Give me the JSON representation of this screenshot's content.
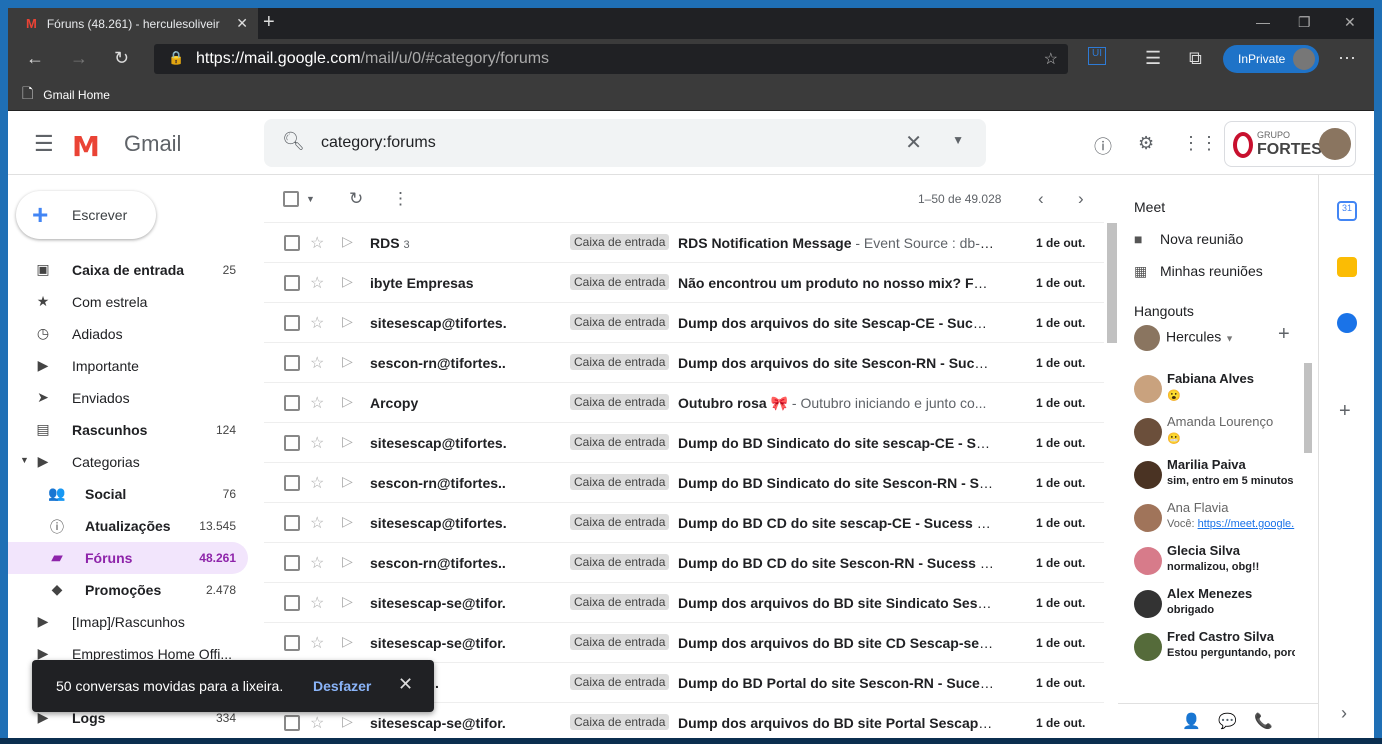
{
  "browser": {
    "tab_title": "Fóruns (48.261) - herculesoliveir",
    "favicon": "M",
    "url_host": "https://mail.google.com",
    "url_path": "/mail/u/0/#category/forums",
    "inprivate": "InPrivate",
    "favorite": "Gmail Home"
  },
  "header": {
    "app_name": "Gmail",
    "search_query": "category:forums",
    "brand_top": "GRUPO",
    "brand_name": "FORTES"
  },
  "compose": "Escrever",
  "nav": [
    {
      "label": "Caixa de entrada",
      "count": "25",
      "icon": "inbox-icon",
      "glyph": "▣",
      "bold": true
    },
    {
      "label": "Com estrela",
      "count": "",
      "icon": "star-icon",
      "glyph": "★",
      "bold": false
    },
    {
      "label": "Adiados",
      "count": "",
      "icon": "clock-icon",
      "glyph": "◷",
      "bold": false
    },
    {
      "label": "Importante",
      "count": "",
      "icon": "important-icon",
      "glyph": "▶",
      "bold": false
    },
    {
      "label": "Enviados",
      "count": "",
      "icon": "send-icon",
      "glyph": "➤",
      "bold": false
    },
    {
      "label": "Rascunhos",
      "count": "124",
      "icon": "draft-icon",
      "glyph": "▤",
      "bold": true
    },
    {
      "label": "Categorias",
      "count": "",
      "icon": "label-icon",
      "glyph": "▶",
      "bold": false
    },
    {
      "label": "Social",
      "count": "76",
      "icon": "people-icon",
      "glyph": "👥",
      "sub": true
    },
    {
      "label": "Atualizações",
      "count": "13.545",
      "icon": "info-icon",
      "glyph": "ⓘ",
      "sub": true
    },
    {
      "label": "Fóruns",
      "count": "48.261",
      "icon": "forum-icon",
      "glyph": "▰",
      "sub": true,
      "active": true
    },
    {
      "label": "Promoções",
      "count": "2.478",
      "icon": "tag-icon",
      "glyph": "◆",
      "sub": true
    },
    {
      "label": "[Imap]/Rascunhos",
      "count": "",
      "icon": "label-icon",
      "glyph": "▶",
      "bold": false
    },
    {
      "label": "Emprestimos Home Offi...",
      "count": "",
      "icon": "label-icon",
      "glyph": "▶",
      "bold": false
    },
    {
      "label": "",
      "count": "",
      "icon": "label-icon",
      "glyph": "",
      "bold": false
    },
    {
      "label": "Logs",
      "count": "334",
      "icon": "label-icon",
      "glyph": "▶",
      "bold": true
    }
  ],
  "toolbar": {
    "pagination": "1–50 de 49.028"
  },
  "emails": [
    {
      "sender": "RDS",
      "thread": "3",
      "label": "Caixa de entrada",
      "subject": "RDS Notification Message",
      "snippet": " - Event Source : db-i...",
      "date": "1 de out."
    },
    {
      "sender": "ibyte Empresas",
      "thread": "",
      "label": "Caixa de entrada",
      "subject": "Não encontrou um produto no nosso mix? Faça...",
      "snippet": "",
      "date": "1 de out."
    },
    {
      "sender": "sitesescap@tifortes.",
      "thread": "",
      "label": "Caixa de entrada",
      "subject": "Dump dos arquivos do site Sescap-CE - Sucess",
      "snippet": " -",
      "date": "1 de out."
    },
    {
      "sender": "sescon-rn@tifortes..",
      "thread": "",
      "label": "Caixa de entrada",
      "subject": "Dump dos arquivos do site Sescon-RN - Sucess",
      "snippet": " -",
      "date": "1 de out."
    },
    {
      "sender": "Arcopy",
      "thread": "",
      "label": "Caixa de entrada",
      "subject": "Outubro rosa 🎀",
      "snippet": " - Outubro iniciando e junto co...",
      "date": "1 de out."
    },
    {
      "sender": "sitesescap@tifortes.",
      "thread": "",
      "label": "Caixa de entrada",
      "subject": "Dump do BD Sindicato do site sescap-CE - Suc...",
      "snippet": "",
      "date": "1 de out."
    },
    {
      "sender": "sescon-rn@tifortes..",
      "thread": "",
      "label": "Caixa de entrada",
      "subject": "Dump do BD Sindicato do site Sescon-RN - Su...",
      "snippet": "",
      "date": "1 de out."
    },
    {
      "sender": "sitesescap@tifortes.",
      "thread": "",
      "label": "Caixa de entrada",
      "subject": "Dump do BD CD do site sescap-CE - Sucess",
      "snippet": " - A...",
      "date": "1 de out."
    },
    {
      "sender": "sescon-rn@tifortes..",
      "thread": "",
      "label": "Caixa de entrada",
      "subject": "Dump do BD CD do site Sescon-RN - Sucess",
      "snippet": " - A...",
      "date": "1 de out."
    },
    {
      "sender": "sitesescap-se@tifor.",
      "thread": "",
      "label": "Caixa de entrada",
      "subject": "Dump dos arquivos do BD site Sindicato Sesca...",
      "snippet": "",
      "date": "1 de out."
    },
    {
      "sender": "sitesescap-se@tifor.",
      "thread": "",
      "label": "Caixa de entrada",
      "subject": "Dump dos arquivos do BD site CD Sescap-se",
      "snippet": " - A...",
      "date": "1 de out."
    },
    {
      "sender": "@tifortes..",
      "thread": "",
      "label": "Caixa de entrada",
      "subject": "Dump do BD Portal do site Sescon-RN - Sucess",
      "snippet": " -",
      "date": "1 de out."
    },
    {
      "sender": "sitesescap-se@tifor.",
      "thread": "",
      "label": "Caixa de entrada",
      "subject": "Dump dos arquivos do BD site Portal Sescap-se",
      "snippet": " -",
      "date": "1 de out."
    }
  ],
  "right_panel": {
    "meet_title": "Meet",
    "new_meeting": "Nova reunião",
    "my_meetings": "Minhas reuniões",
    "hangouts_title": "Hangouts",
    "user": "Hercules",
    "contacts": [
      {
        "name": "Fabiana Alves",
        "msg": "😮",
        "bold": true,
        "color": "#c9a27e"
      },
      {
        "name": "Amanda Lourenço",
        "msg": "😬",
        "bold": false,
        "color": "#6b4f3b"
      },
      {
        "name": "Marilia Paiva",
        "msg": "sim, entro em 5 minutos",
        "bold": true,
        "color": "#4a3323"
      },
      {
        "name": "Ana Flavia",
        "msg_prefix": "Você: ",
        "msg_link": "https://meet.google.",
        "bold": false,
        "color": "#a0745a"
      },
      {
        "name": "Glecia Silva",
        "msg": "normalizou, obg!!",
        "bold": true,
        "color": "#d77b8a"
      },
      {
        "name": "Alex Menezes",
        "msg": "obrigado",
        "bold": true,
        "color": "#333"
      },
      {
        "name": "Fred Castro Silva",
        "msg": "Estou perguntando, porc",
        "bold": true,
        "color": "#556b3a"
      }
    ]
  },
  "toast": {
    "message": "50 conversas movidas para a lixeira.",
    "undo": "Desfazer"
  },
  "colors": {
    "accent": "#8e24aa",
    "active_bg": "#f2e5fc",
    "toast_bg": "#202124",
    "link": "#8ab4f8"
  }
}
